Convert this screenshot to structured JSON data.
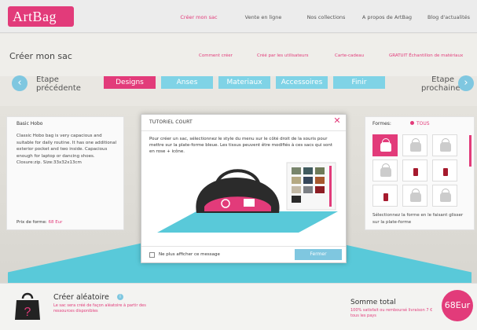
{
  "brand": {
    "logo_text": "ArtBag",
    "accent": "#e23b7a",
    "secondary": "#7fc7e0"
  },
  "topnav": [
    {
      "label": "Créer mon sac",
      "active": true
    },
    {
      "label": "Vente en ligne"
    },
    {
      "label": "Nos collections"
    },
    {
      "label": "A propos de ArtBag"
    },
    {
      "label": "Blog d'actualités"
    }
  ],
  "page": {
    "title": "Créer mon sac"
  },
  "subnav": [
    {
      "label": "Comment créer"
    },
    {
      "label": "Créé par les utilisateurs"
    },
    {
      "label": "Carte-cadeau"
    },
    {
      "label": "GRATUIT Échantillon de matériaux"
    }
  ],
  "steps": {
    "prev_line1": "Etape",
    "prev_line2": "précédente",
    "next_line1": "Etape",
    "next_line2": "prochaine",
    "prev_icon": "arrow-left-icon",
    "next_icon": "arrow-right-icon",
    "tabs": [
      {
        "label": "Designs",
        "active": true
      },
      {
        "label": "Anses"
      },
      {
        "label": "Materiaux"
      },
      {
        "label": "Accessoires"
      },
      {
        "label": "Finir"
      }
    ]
  },
  "left_card": {
    "title": "Basic Hobo",
    "description": "Classic Hobo bag is very capacious and suitable for daily routine. It has one additional exterior pocket and two inside. Capacious enough for laptop or dancing shoes. Closure:zip. Size:33x32x13cm",
    "price_label": "Prix de forme:",
    "price_value": "68 Eur"
  },
  "right_card": {
    "formes_label": "Formes:",
    "filter_label": "TOUS",
    "shapes_count_hint": "grid of bag shape thumbnails",
    "hint": "Sélectionnez la forme en le faisant glisser sur la plate-forme"
  },
  "modal": {
    "title": "TUTORIEL COURT",
    "text": "Pour créer un sac, sélectionnez le style du menu sur le côté droit de la souris pour mettre sur la plate-forme bleue. Les tissus peuvent être modifiés à ces sacs qui sont en rose + icône.",
    "checkbox_label": "Ne plus afficher ce message",
    "close_button": "Fermer",
    "close_icon": "close-icon"
  },
  "bottom": {
    "random_title": "Créer aléatoire",
    "random_desc": "Le sac sera créé de façon aléatoire à partir des ressources disponibles",
    "random_icon": "question-bag-icon",
    "total_title": "Somme total",
    "total_desc": "100% satisfait ou remboursé livraison 7 € tous les pays",
    "total_value": "68Eur"
  }
}
